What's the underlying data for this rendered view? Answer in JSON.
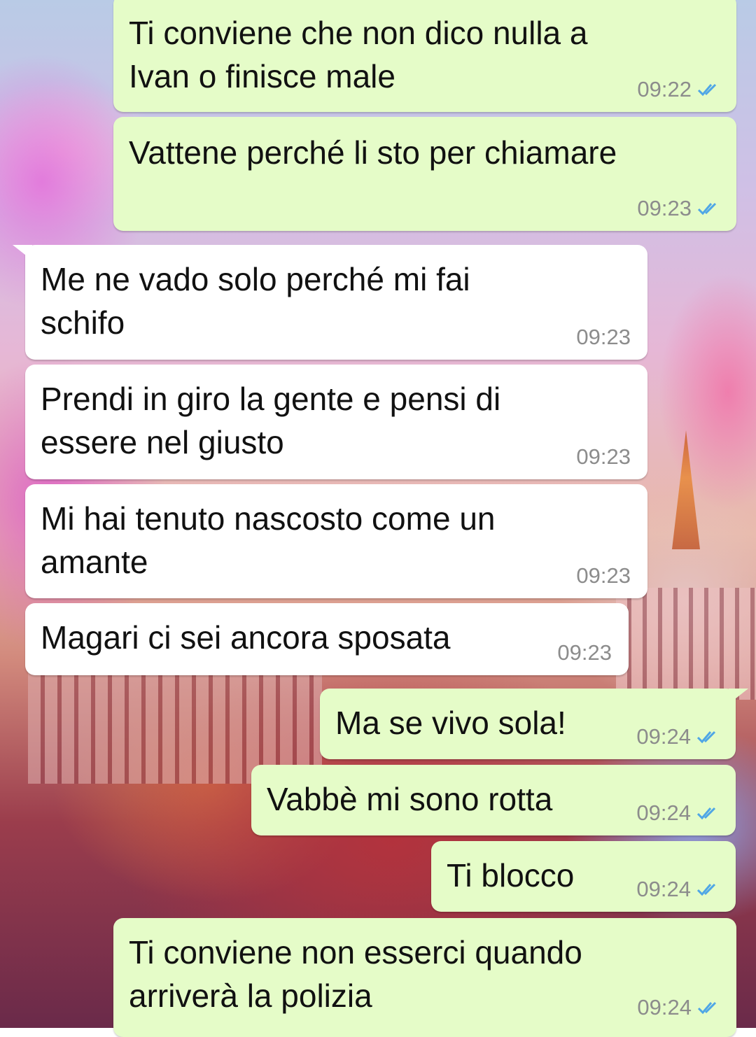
{
  "chat": {
    "messages": [
      {
        "text": "Ti conviene che non dico nulla a\nIvan o finisce male",
        "time": "09:22",
        "dir": "out",
        "status": "read"
      },
      {
        "text": "Vattene perché li sto per chiamare",
        "time": "09:23",
        "dir": "out",
        "status": "read"
      },
      {
        "text": "Me ne vado solo perché mi fai\nschifo",
        "time": "09:23",
        "dir": "in"
      },
      {
        "text": "Prendi in giro la gente e pensi di\nessere nel giusto",
        "time": "09:23",
        "dir": "in"
      },
      {
        "text": "Mi hai tenuto nascosto come un\namante",
        "time": "09:23",
        "dir": "in"
      },
      {
        "text": "Magari ci sei ancora sposata",
        "time": "09:23",
        "dir": "in"
      },
      {
        "text": "Ma se vivo sola!",
        "time": "09:24",
        "dir": "out",
        "status": "read"
      },
      {
        "text": "Vabbè mi sono rotta",
        "time": "09:24",
        "dir": "out",
        "status": "read"
      },
      {
        "text": "Ti blocco",
        "time": "09:24",
        "dir": "out",
        "status": "read"
      },
      {
        "text": "Ti conviene non esserci quando\narriverà la polizia",
        "time": "09:24",
        "dir": "out",
        "status": "read"
      }
    ]
  },
  "colors": {
    "outgoing_bubble": "#e5fcc8",
    "incoming_bubble": "#ffffff",
    "read_ticks": "#4fa6e6",
    "timestamp": "#8c8c8c"
  },
  "icons": {
    "read_receipt": "double-check-icon"
  }
}
